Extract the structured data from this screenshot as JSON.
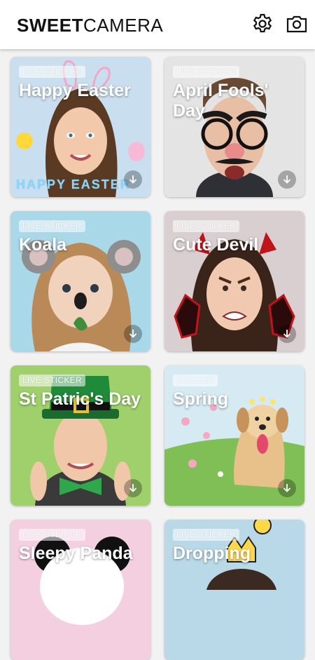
{
  "app": {
    "brand_bold": "SWEET",
    "brand_regular": "CAMERA"
  },
  "header_icons": {
    "settings": "gear-icon",
    "camera": "camera-icon"
  },
  "cards": [
    {
      "tag": "LIVE STICKER",
      "title": "Happy Easter",
      "decor": "HAPPY EASTER"
    },
    {
      "tag": "LIVE STICKER",
      "title": "April Fools' Day"
    },
    {
      "tag": "LIVE STICKER",
      "title": "Koala"
    },
    {
      "tag": "LIVE STICKER",
      "title": "Cute Devil"
    },
    {
      "tag": "LIVE STICKER",
      "title": "St Patric's Day"
    },
    {
      "tag": "STICKER",
      "title": "Spring"
    },
    {
      "tag": "LIVE STICKER",
      "title": "Sleepy Panda"
    },
    {
      "tag": "LIVE STICKER",
      "title": "Dropping"
    }
  ],
  "colors": {
    "background": "#f2f2f2",
    "card_download_overlay": "#00000047"
  }
}
